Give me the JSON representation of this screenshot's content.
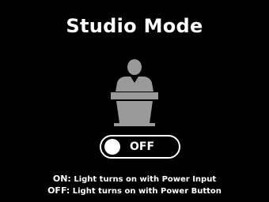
{
  "screen": {
    "title": "Studio Mode",
    "background": "#000000",
    "foreground": "#ffffff",
    "icon_color": "#9a9a9a"
  },
  "mode_icon": {
    "name": "speaker-at-podium-icon"
  },
  "toggle": {
    "state_label": "OFF",
    "is_on": false
  },
  "help": {
    "on_key": "ON:",
    "on_text": " Light turns on with Power Input",
    "off_key": "OFF:",
    "off_text": " Light turns on with Power Button"
  }
}
